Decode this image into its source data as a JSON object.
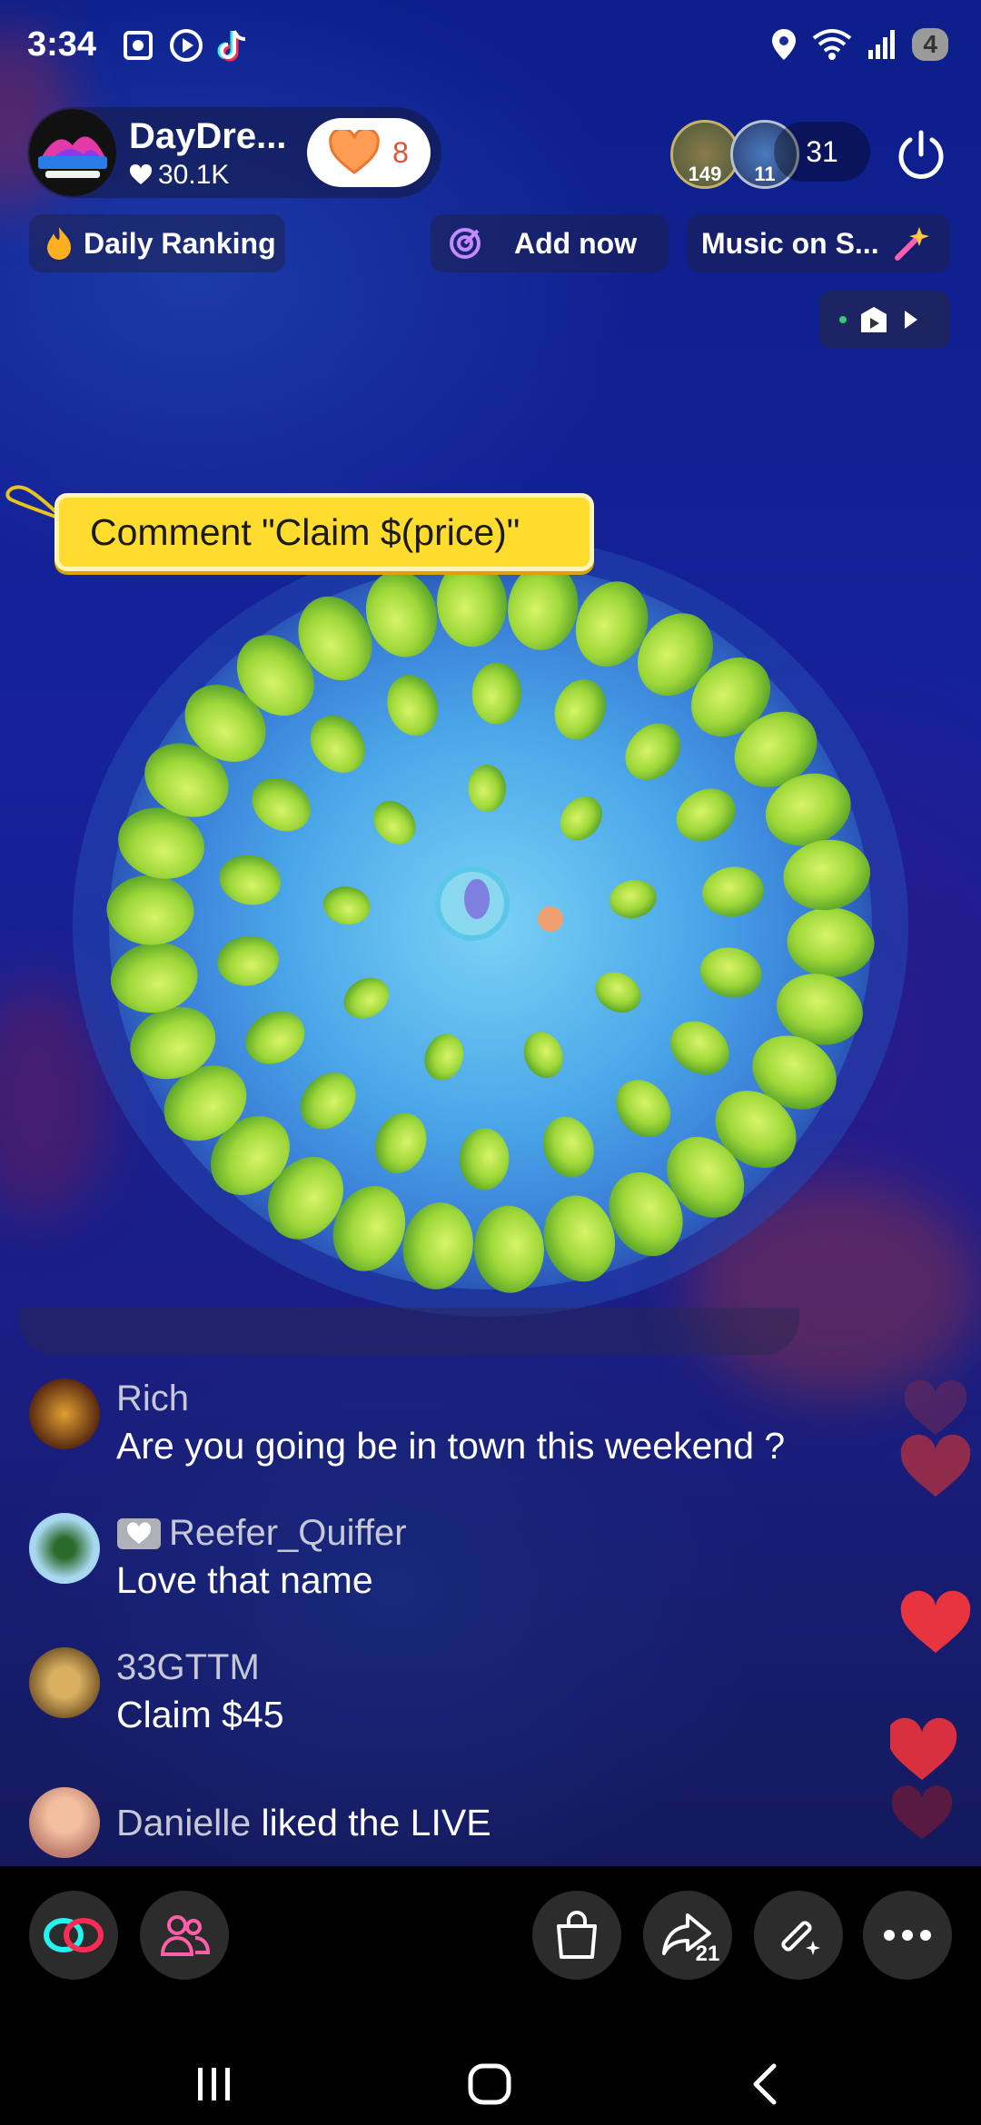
{
  "status_bar": {
    "time": "3:34",
    "battery": "4"
  },
  "host": {
    "name": "DayDre...",
    "likes": "30.1K",
    "follow_count": "8"
  },
  "viewers": {
    "badge_1": "149",
    "badge_2": "11",
    "count": "31"
  },
  "pills": {
    "daily_ranking": "Daily Ranking",
    "add_now": "Add now",
    "music": "Music on S..."
  },
  "pinned_comment": "Comment \"Claim $(price)\"",
  "comments": [
    {
      "user": "Rich",
      "message": "Are you going be in town this weekend ?"
    },
    {
      "user": "Reefer_Quiffer",
      "message": "Love that name"
    },
    {
      "user": "33GTTM",
      "message": "Claim $45"
    }
  ],
  "liked": {
    "user": "Danielle",
    "text": " liked the LIVE"
  },
  "toolbar": {
    "share_count": "21"
  },
  "colors": {
    "accent": "#fe2c55",
    "pinned_bg": "#ffdc2e",
    "heart": "#e8343f"
  }
}
